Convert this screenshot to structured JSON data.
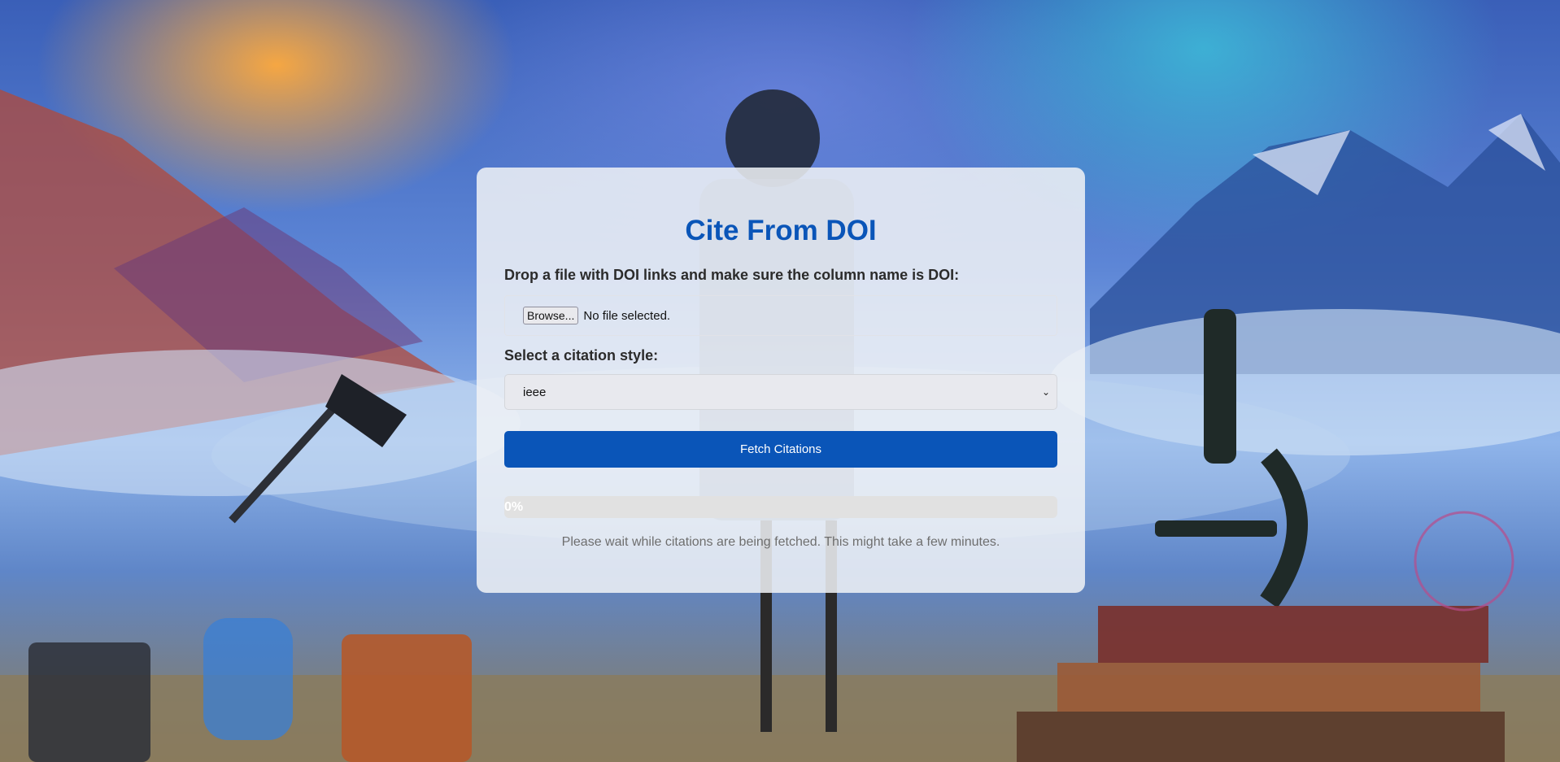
{
  "page": {
    "title": "Cite From DOI"
  },
  "upload": {
    "label": "Drop a file with DOI links and make sure the column name is DOI:",
    "browse_label": "Browse...",
    "status": "No file selected."
  },
  "style_select": {
    "label": "Select a citation style:",
    "selected": "ieee"
  },
  "fetch_button": {
    "label": "Fetch Citations"
  },
  "progress": {
    "value": 0,
    "text": "0%"
  },
  "note": "Please wait while citations are being fetched. This might take a few minutes.",
  "colors": {
    "accent": "#0a55b8",
    "progress_track": "#e1e1e1"
  }
}
